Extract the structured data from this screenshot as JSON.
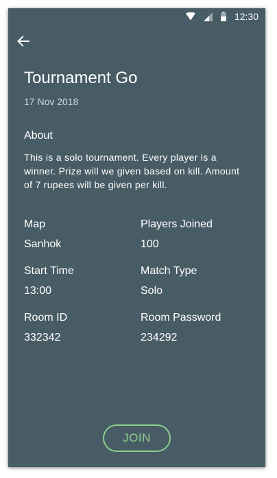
{
  "status_bar": {
    "time": "12:30",
    "icons": [
      "wifi-icon",
      "signal-icon",
      "battery-icon"
    ]
  },
  "header": {
    "back_icon": "arrow-left-icon"
  },
  "tournament": {
    "title": "Tournament Go",
    "date": "17 Nov 2018"
  },
  "about": {
    "heading": "About",
    "text": "This is a solo tournament. Every player is a winner. Prize will we given based on kill. Amount of 7 rupees will be given per kill."
  },
  "details": {
    "map": {
      "label": "Map",
      "value": "Sanhok"
    },
    "players_joined": {
      "label": "Players Joined",
      "value": "100"
    },
    "start_time": {
      "label": "Start Time",
      "value": "13:00"
    },
    "match_type": {
      "label": "Match Type",
      "value": "Solo"
    },
    "room_id": {
      "label": "Room ID",
      "value": "332342"
    },
    "room_password": {
      "label": "Room Password",
      "value": "234292"
    }
  },
  "actions": {
    "join_label": "JOIN"
  },
  "colors": {
    "background": "#485c65",
    "accent": "#8bcf8d",
    "text": "#ffffff",
    "muted_text": "#d2dadd"
  }
}
